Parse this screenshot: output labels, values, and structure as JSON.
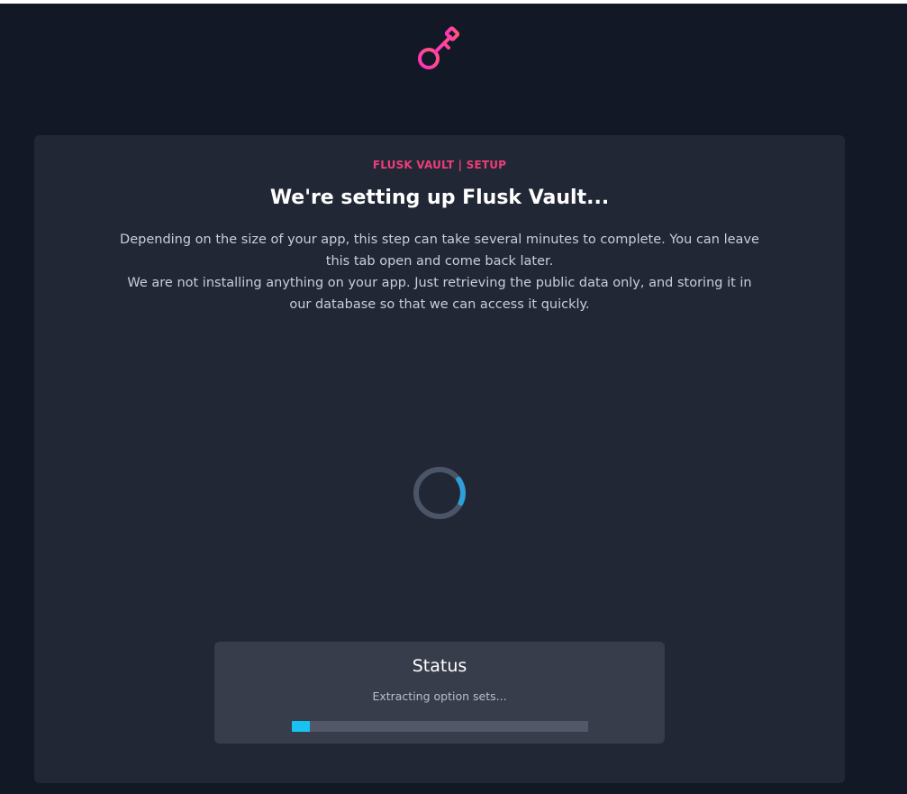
{
  "header": {
    "logo_icon": "key-icon"
  },
  "card": {
    "eyebrow": "FLUSK VAULT | SETUP",
    "title": "We're setting up Flusk Vault...",
    "description_1": "Depending on the size of your app, this step can take several minutes to complete. You can leave this tab open and come back later.",
    "description_2": "We are not installing anything on your app. Just retrieving the public data only, and storing it in our database so that we can access it quickly.",
    "spinner_icon": "loading-spinner-icon"
  },
  "status": {
    "title": "Status",
    "text": "Extracting option sets...",
    "progress_fraction": 0.06
  },
  "colors": {
    "background": "#131826",
    "card": "#222736",
    "status_box": "#383d4b",
    "accent_pink": "#ec3d77",
    "progress": "#18c2f1",
    "spinner_arc": "#2e9fd8"
  }
}
